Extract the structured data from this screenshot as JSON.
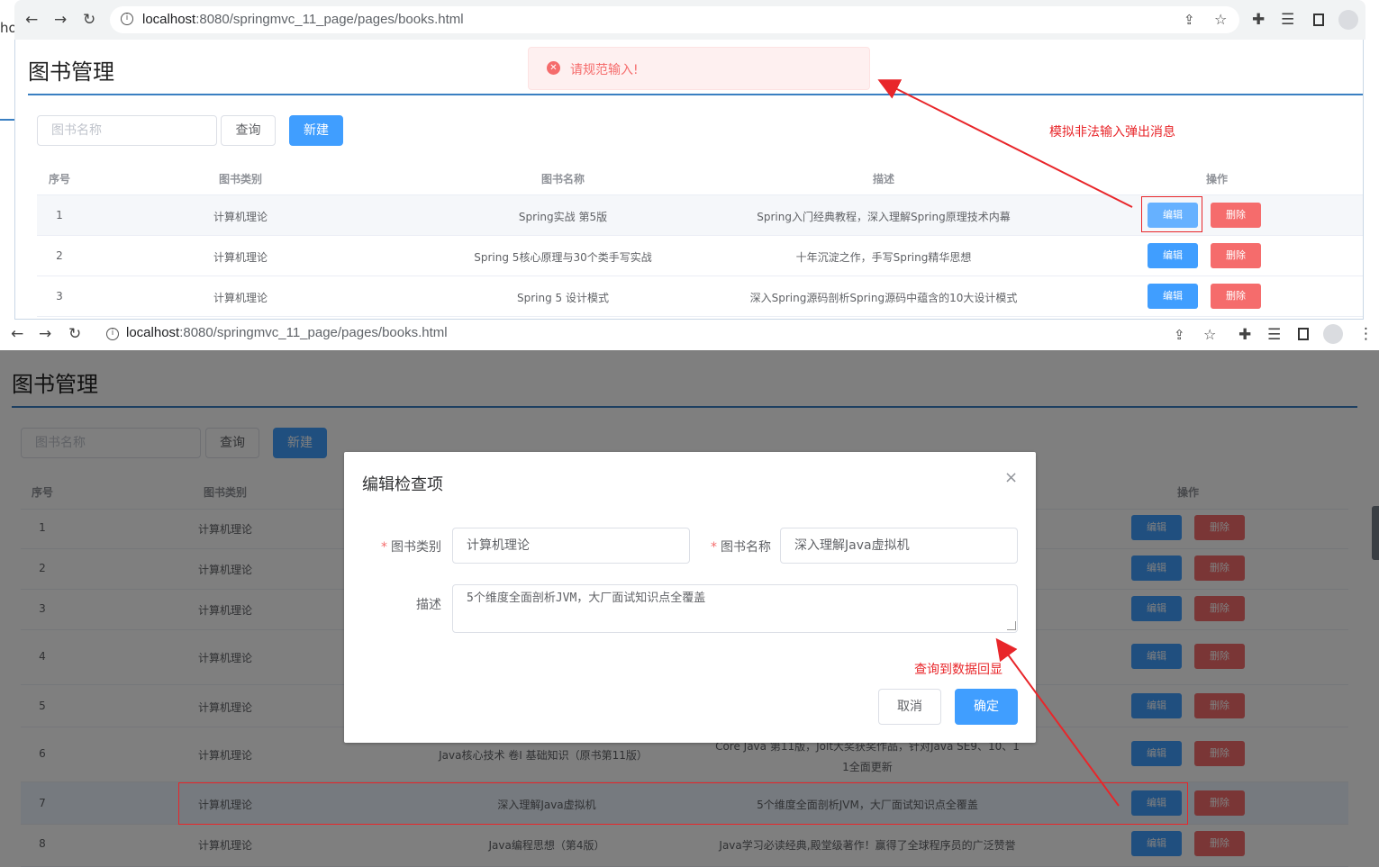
{
  "top": {
    "browser": {
      "url_host": "localhost",
      "url_rest": ":8080/springmvc_11_page/pages/books.html",
      "left_edge_text": "ho"
    },
    "page_title": "图书管理",
    "message": {
      "text": "请规范输入!",
      "type": "error"
    },
    "search": {
      "placeholder": "图书名称",
      "query_label": "查询",
      "new_label": "新建"
    },
    "headers": {
      "id": "序号",
      "type": "图书类别",
      "name": "图书名称",
      "desc": "描述",
      "ops": "操作"
    },
    "rows": [
      {
        "id": "1",
        "type": "计算机理论",
        "name": "Spring实战 第5版",
        "desc": "Spring入门经典教程，深入理解Spring原理技术内幕"
      },
      {
        "id": "2",
        "type": "计算机理论",
        "name": "Spring 5核心原理与30个类手写实战",
        "desc": "十年沉淀之作，手写Spring精华思想"
      },
      {
        "id": "3",
        "type": "计算机理论",
        "name": "Spring 5 设计模式",
        "desc": "深入Spring源码剖析Spring源码中蕴含的10大设计模式"
      }
    ],
    "edit_label": "编辑",
    "delete_label": "删除",
    "annotation": "模拟非法输入弹出消息"
  },
  "bottom": {
    "browser": {
      "url_host": "localhost",
      "url_rest": ":8080/springmvc_11_page/pages/books.html"
    },
    "page_title": "图书管理",
    "search": {
      "placeholder": "图书名称",
      "query_label": "查询",
      "new_label": "新建"
    },
    "headers": {
      "id": "序号",
      "type": "图书类别",
      "ops": "操作"
    },
    "rows": [
      {
        "id": "1",
        "type": "计算机理论",
        "name": "",
        "desc": ""
      },
      {
        "id": "2",
        "type": "计算机理论",
        "name": "",
        "desc": ""
      },
      {
        "id": "3",
        "type": "计算机理论",
        "name": "",
        "desc": ""
      },
      {
        "id": "4",
        "type": "计算机理论",
        "name": "",
        "desc": ""
      },
      {
        "id": "5",
        "type": "计算机理论",
        "name": "",
        "desc": ""
      },
      {
        "id": "6",
        "type": "计算机理论",
        "name": "Java核心技术 卷I 基础知识（原书第11版）",
        "desc_line1": "Core Java 第11版，Jolt大奖获奖作品，针对Java SE9、10、1",
        "desc_line2": "1全面更新"
      },
      {
        "id": "7",
        "type": "计算机理论",
        "name": "深入理解Java虚拟机",
        "desc": "5个维度全面剖析JVM，大厂面试知识点全覆盖"
      },
      {
        "id": "8",
        "type": "计算机理论",
        "name": "Java编程思想（第4版）",
        "desc": "Java学习必读经典,殿堂级著作！赢得了全球程序员的广泛赞誉"
      }
    ],
    "edit_label": "编辑",
    "delete_label": "删除",
    "dialog": {
      "title": "编辑检查项",
      "type_label": "图书类别",
      "type_value": "计算机理论",
      "name_label": "图书名称",
      "name_value": "深入理解Java虚拟机",
      "desc_label": "描述",
      "desc_value": "5个维度全面剖析JVM，大厂面试知识点全覆盖",
      "cancel_label": "取消",
      "confirm_label": "确定"
    },
    "annotation": "查询到数据回显"
  }
}
